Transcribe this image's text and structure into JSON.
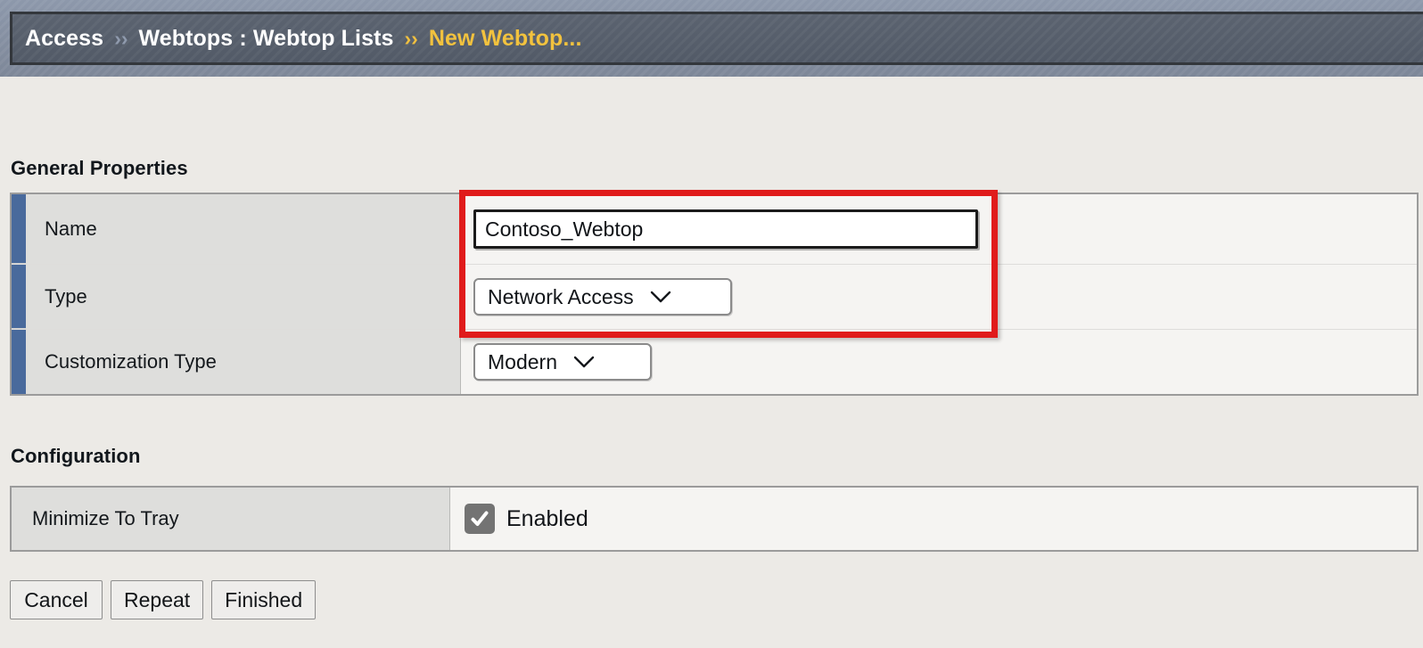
{
  "breadcrumb": {
    "items": [
      {
        "label": "Access",
        "current": false
      },
      {
        "label": "Webtops : Webtop Lists",
        "current": false
      },
      {
        "label": "New Webtop...",
        "current": true
      }
    ],
    "separator": "››"
  },
  "sections": {
    "general": {
      "heading": "General Properties",
      "rows": [
        {
          "label": "Name",
          "control": "text-input",
          "value": "Contoso_Webtop",
          "placeholder": ""
        },
        {
          "label": "Type",
          "control": "select",
          "value": "Network Access"
        },
        {
          "label": "Customization Type",
          "control": "select",
          "value": "Modern"
        }
      ]
    },
    "configuration": {
      "heading": "Configuration",
      "rows": [
        {
          "label": "Minimize To Tray",
          "control": "checkbox",
          "checked": true,
          "value": "Enabled"
        }
      ]
    }
  },
  "buttons": [
    {
      "label": "Cancel"
    },
    {
      "label": "Repeat"
    },
    {
      "label": "Finished"
    }
  ],
  "icons": {
    "chevron_down": "chevron-down-icon",
    "checkmark": "checkmark-icon"
  },
  "colors": {
    "header_bg": "#555d6a",
    "header_border": "#33373c",
    "breadcrumb_text": "#ffffff",
    "breadcrumb_current": "#f2c23e",
    "breadcrumb_separator": "#8f9aad",
    "accent_bar": "#496a9c",
    "label_cell_bg": "#dededc",
    "value_cell_bg": "#f5f4f2",
    "page_bg": "#eceae6",
    "highlight_red": "#e01b1b",
    "checkbox_bg": "#737373"
  }
}
